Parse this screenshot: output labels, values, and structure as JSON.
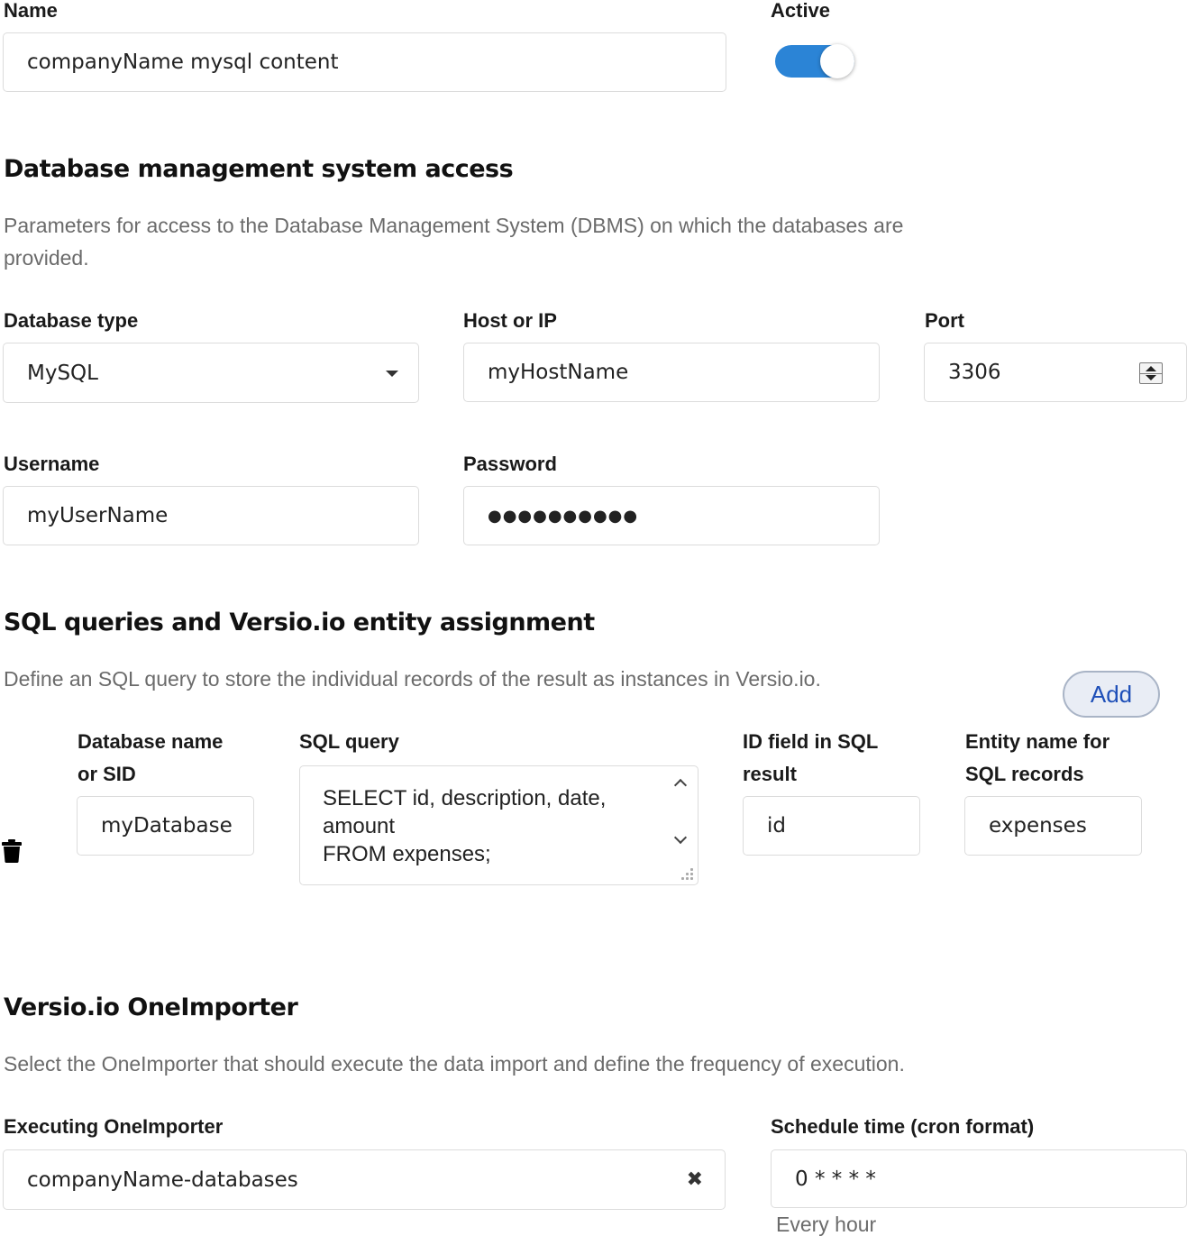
{
  "general": {
    "name_label": "Name",
    "name_value": "companyName mysql content",
    "active_label": "Active",
    "active_on": true
  },
  "dbms": {
    "heading": "Database management system access",
    "description_line1": "Parameters for access to the Database Management System (DBMS) on which the databases are",
    "description_line2": "provided.",
    "db_type_label": "Database type",
    "db_type_value": "MySQL",
    "host_label": "Host or IP",
    "host_value": "myHostName",
    "port_label": "Port",
    "port_value": "3306",
    "username_label": "Username",
    "username_value": "myUserName",
    "password_label": "Password",
    "password_value": "●●●●●●●●●●"
  },
  "sql": {
    "heading": "SQL queries and Versio.io entity assignment",
    "description": "Define an SQL query to store the individual records of the result as instances in Versio.io.",
    "add_label": "Add",
    "db_name_label_line1": "Database name",
    "db_name_label_line2": "or SID",
    "db_name_value": "myDatabase",
    "query_label": "SQL query",
    "query_lines": [
      "SELECT id, description, date,",
      "amount",
      "FROM expenses;"
    ],
    "id_field_label_line1": "ID field in SQL",
    "id_field_label_line2": "result",
    "id_field_value": "id",
    "entity_label_line1": "Entity name for",
    "entity_label_line2": "SQL records",
    "entity_value": "expenses"
  },
  "importer": {
    "heading": "Versio.io OneImporter",
    "description": "Select the OneImporter that should execute the data import and define the frequency of execution.",
    "executing_label": "Executing OneImporter",
    "executing_value": "companyName-databases",
    "schedule_label": "Schedule time (cron format)",
    "schedule_value": "0 * * * *",
    "schedule_hint": "Every hour"
  },
  "colors": {
    "toggle_on": "#2b84d6",
    "add_button_text": "#1e4fb8",
    "add_button_bg": "#e9edf5"
  },
  "icons": [
    "caret-down-icon",
    "spinner-icon",
    "trash-icon",
    "clear-icon",
    "scroll-up-icon",
    "scroll-down-icon",
    "resize-grip-icon"
  ]
}
